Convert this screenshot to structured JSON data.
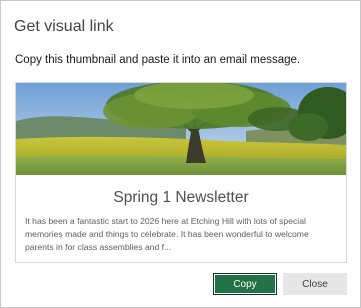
{
  "dialog": {
    "title": "Get visual link",
    "instruction": "Copy this thumbnail and paste it into an email message."
  },
  "card": {
    "image_icon": "landscape-tree-photo",
    "title": "Spring 1 Newsletter",
    "description": "It has been a fantastic start to 2026 here at Etching Hill with lots of special memories made and things to celebrate. It has been wonderful to welcome parents in for class assemblies and f..."
  },
  "buttons": {
    "copy_label": "Copy",
    "close_label": "Close"
  },
  "colors": {
    "primary_button": "#217346",
    "secondary_button": "#e6e6e6"
  }
}
